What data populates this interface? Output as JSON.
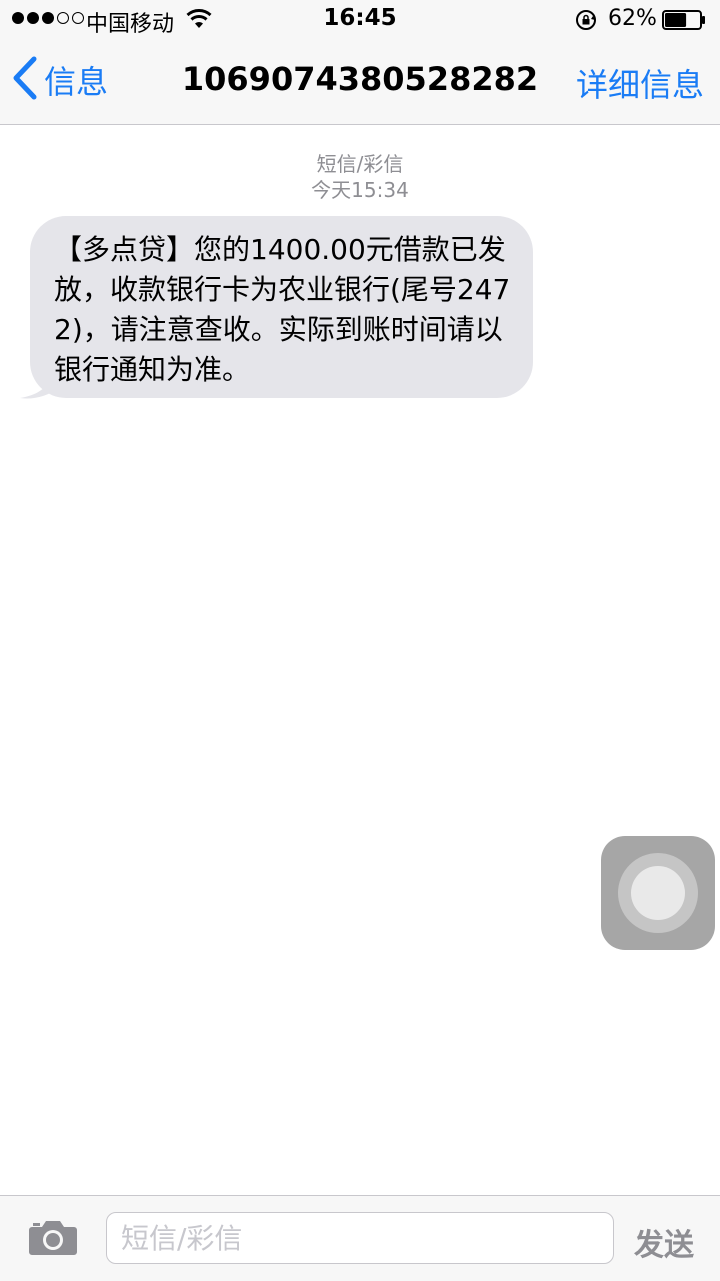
{
  "status_bar": {
    "carrier": "中国移动",
    "time": "16:45",
    "battery_percent": "62%",
    "battery_level": 0.62,
    "signal_full_dots": 3,
    "signal_total_dots": 5
  },
  "nav": {
    "back_label": "信息",
    "title": "1069074380528282",
    "details_label": "详细信息"
  },
  "conversation": {
    "message_type": "短信/彩信",
    "timestamp": "今天15:34",
    "messages": [
      {
        "direction": "incoming",
        "text": "【多点贷】您的1400.00元借款已发放，收款银行卡为农业银行(尾号2472)，请注意查收。实际到账时间请以银行通知为准。"
      }
    ]
  },
  "input_bar": {
    "placeholder": "短信/彩信",
    "value": "",
    "send_label": "发送"
  },
  "colors": {
    "accent": "#1a7cf5",
    "bubble": "#e5e5ea",
    "meta_text": "#8e8e93"
  },
  "icons": {
    "wifi": "wifi-icon",
    "lock": "orientation-lock-icon",
    "battery": "battery-icon",
    "back": "chevron-left-icon",
    "camera": "camera-icon",
    "assistive": "assistive-touch-icon"
  }
}
